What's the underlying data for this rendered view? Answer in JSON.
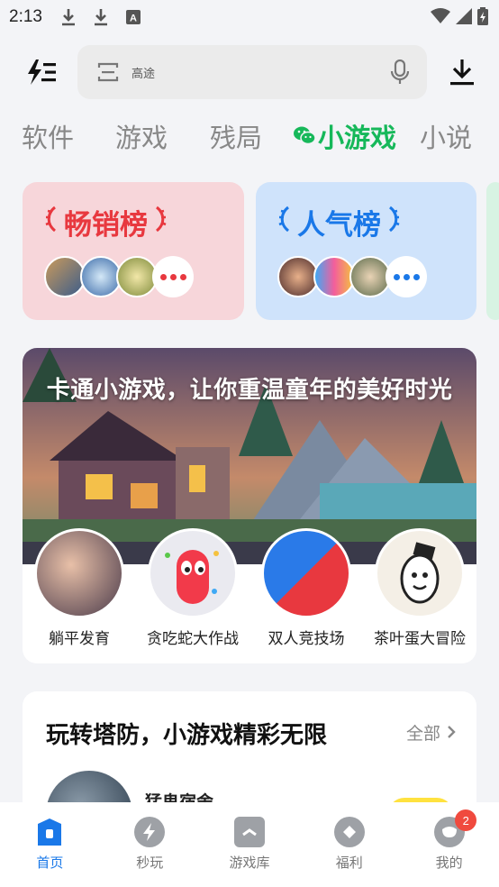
{
  "status_bar": {
    "time": "2:13"
  },
  "header": {
    "menu_icon": "lightning-menu-icon",
    "search": {
      "placeholder": "高途",
      "scan_icon": "scan-icon",
      "mic_icon": "mic-icon"
    },
    "download_icon": "download-icon"
  },
  "tabs": [
    {
      "label": "软件",
      "active": false
    },
    {
      "label": "游戏",
      "active": false
    },
    {
      "label": "残局",
      "active": false
    },
    {
      "label": "小游戏",
      "active": true
    },
    {
      "label": "小说",
      "active": false
    }
  ],
  "rank_cards": [
    {
      "title": "畅销榜",
      "color": "#e8383f",
      "bg": "#f7d6da"
    },
    {
      "title": "人气榜",
      "color": "#1a78e8",
      "bg": "#cfe3fb"
    }
  ],
  "banner": {
    "headline": "卡通小游戏，让你重温童年的美好时光",
    "games": [
      {
        "name": "躺平发育"
      },
      {
        "name": "贪吃蛇大作战"
      },
      {
        "name": "双人竞技场"
      },
      {
        "name": "茶叶蛋大冒险"
      }
    ]
  },
  "section": {
    "title": "玩转塔防，小游戏精彩无限",
    "all_label": "全部",
    "first_item": "猛鬼宿舍"
  },
  "bottom_nav": [
    {
      "label": "首页",
      "active": true
    },
    {
      "label": "秒玩",
      "active": false
    },
    {
      "label": "游戏库",
      "active": false
    },
    {
      "label": "福利",
      "active": false
    },
    {
      "label": "我的",
      "active": false,
      "badge": "2"
    }
  ],
  "colors": {
    "accent_green": "#16b85a",
    "accent_blue": "#1a78e8",
    "badge_red": "#f04a3e"
  }
}
